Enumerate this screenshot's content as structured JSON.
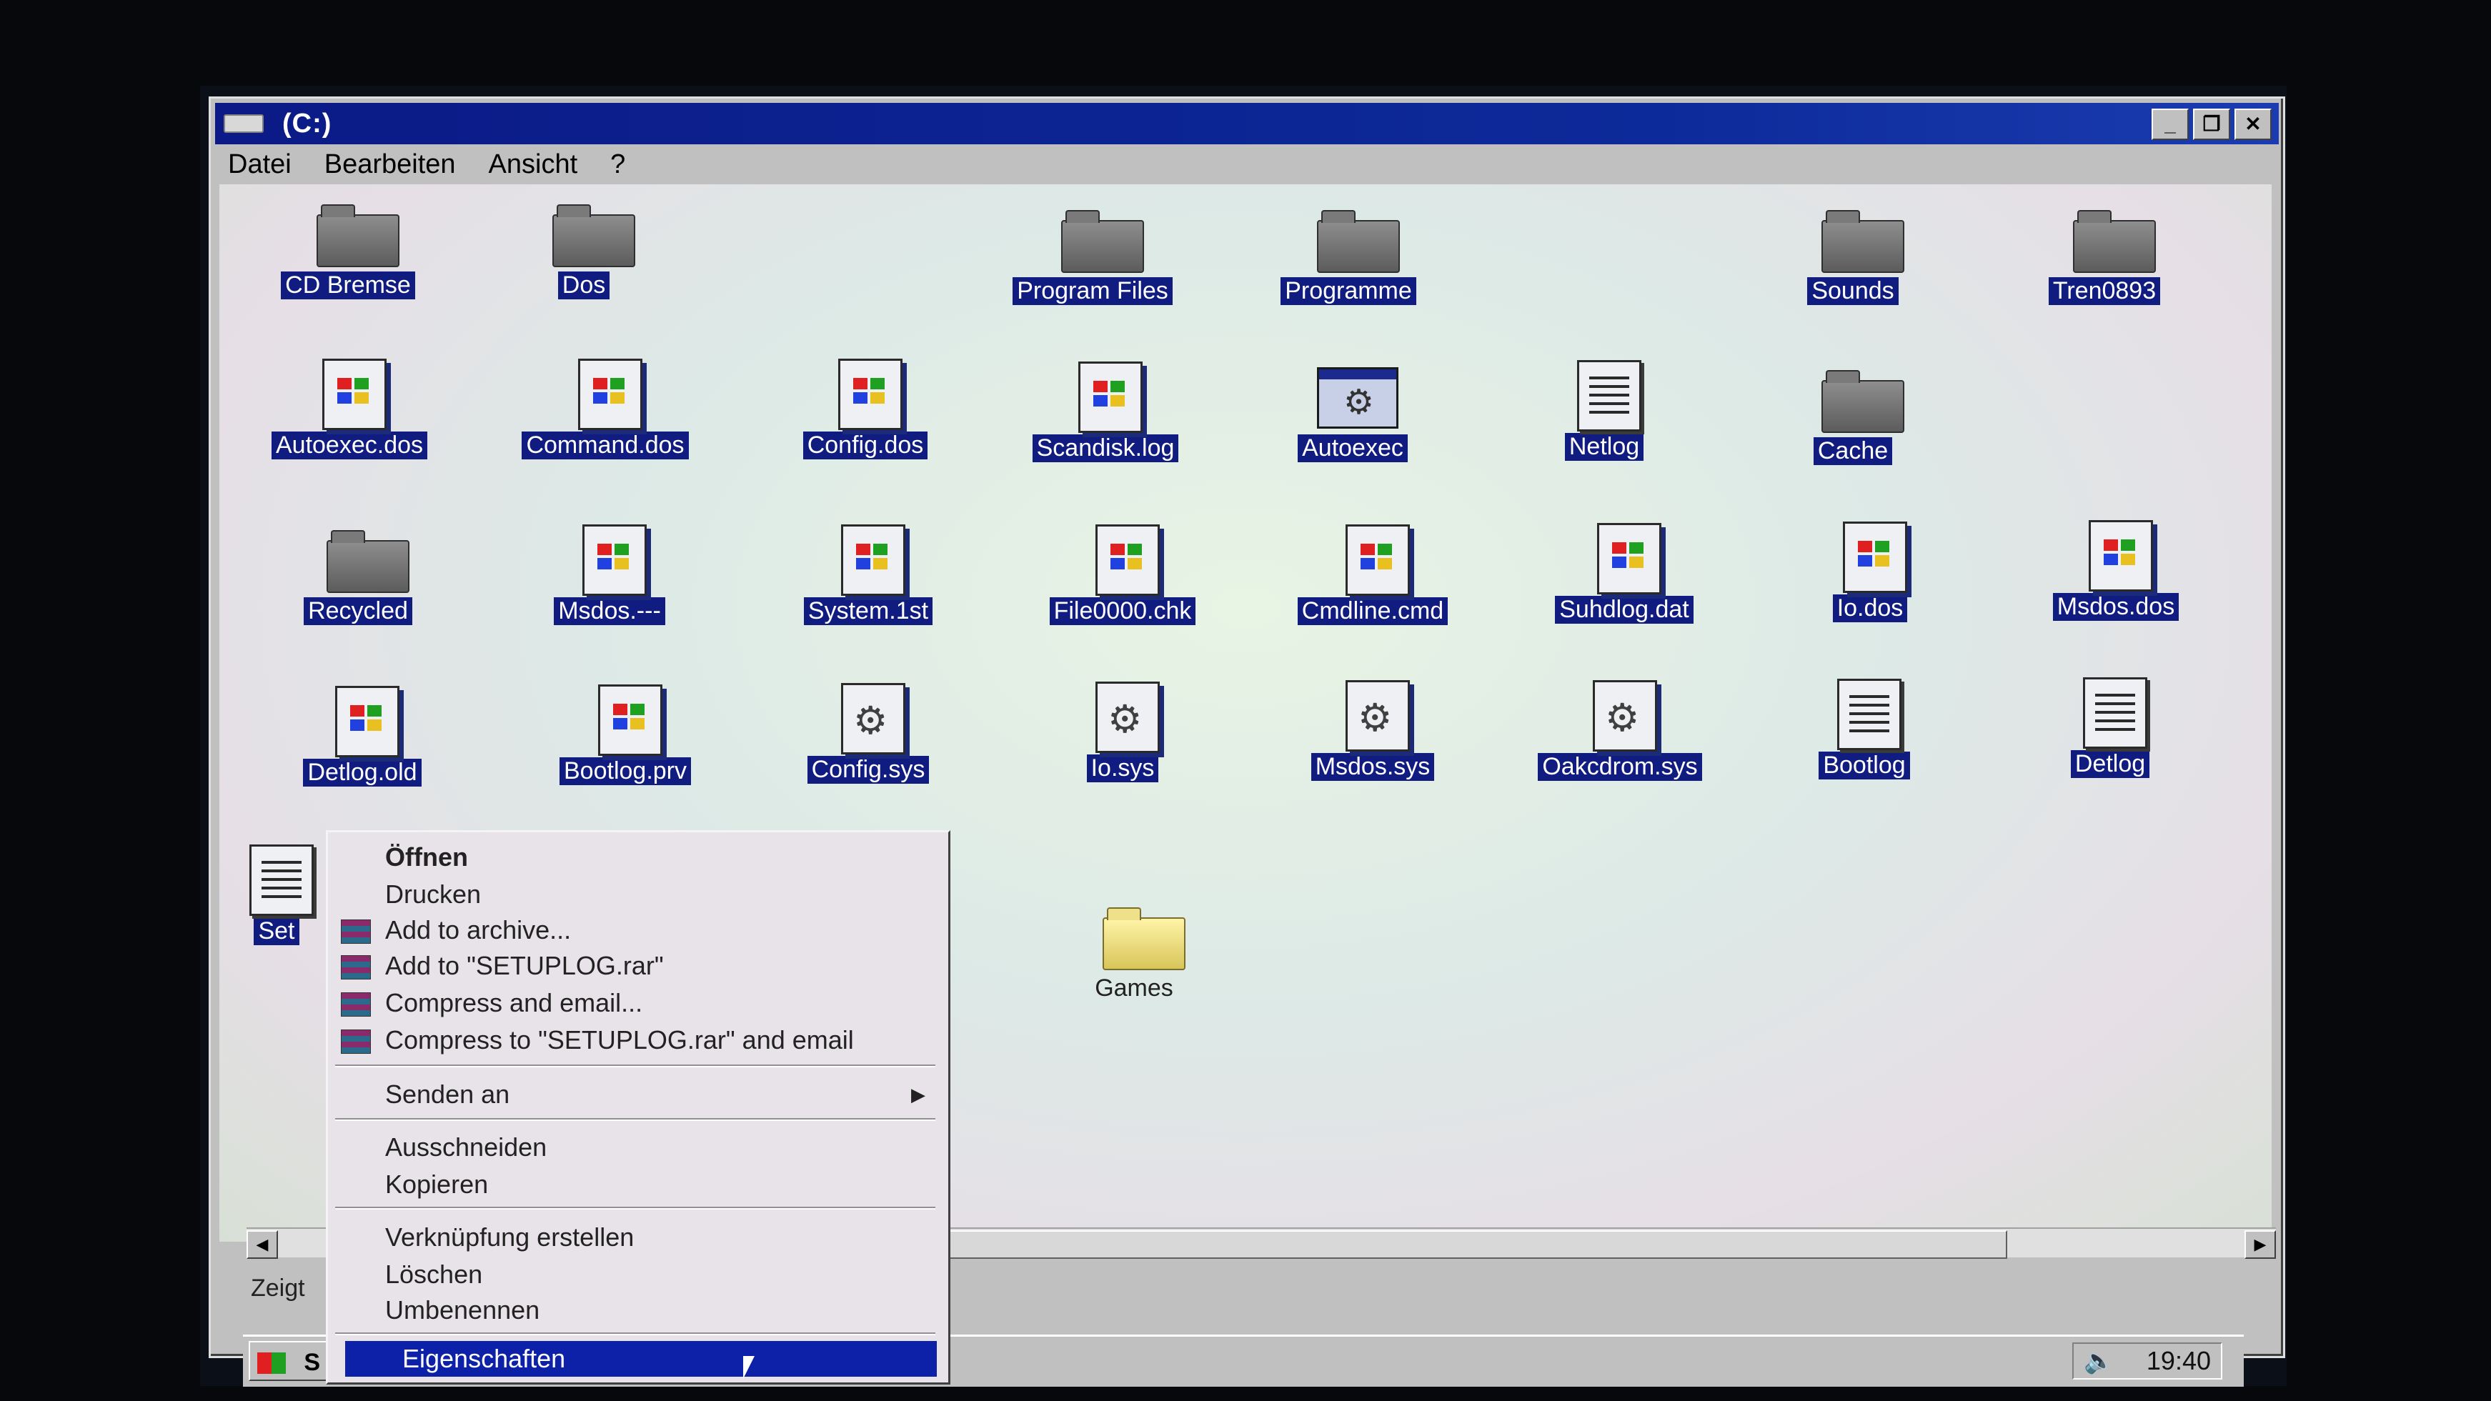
{
  "window": {
    "title": "(C:)",
    "minimize": "_",
    "restore": "❐",
    "close": "✕"
  },
  "menu": [
    "Datei",
    "Bearbeiten",
    "Ansicht",
    "?"
  ],
  "files": [
    {
      "label": "CD Bremse",
      "type": "folder"
    },
    {
      "label": "Dos",
      "type": "folder"
    },
    {
      "label": "Program Files",
      "type": "folder"
    },
    {
      "label": "Programme",
      "type": "folder"
    },
    {
      "label": "Sounds",
      "type": "folder"
    },
    {
      "label": "Tren0893",
      "type": "folder"
    },
    {
      "label": "Autoexec.dos",
      "type": "doc"
    },
    {
      "label": "Command.dos",
      "type": "doc"
    },
    {
      "label": "Config.dos",
      "type": "doc"
    },
    {
      "label": "Scandisk.log",
      "type": "doc"
    },
    {
      "label": "Autoexec",
      "type": "app"
    },
    {
      "label": "Netlog",
      "type": "text"
    },
    {
      "label": "Cache",
      "type": "folder"
    },
    {
      "label": "Recycled",
      "type": "folder"
    },
    {
      "label": "Msdos.---",
      "type": "doc"
    },
    {
      "label": "System.1st",
      "type": "doc"
    },
    {
      "label": "File0000.chk",
      "type": "doc"
    },
    {
      "label": "Cmdline.cmd",
      "type": "doc"
    },
    {
      "label": "Suhdlog.dat",
      "type": "doc"
    },
    {
      "label": "Io.dos",
      "type": "doc"
    },
    {
      "label": "Msdos.dos",
      "type": "doc"
    },
    {
      "label": "Detlog.old",
      "type": "doc"
    },
    {
      "label": "Bootlog.prv",
      "type": "doc"
    },
    {
      "label": "Config.sys",
      "type": "gear"
    },
    {
      "label": "Io.sys",
      "type": "gear"
    },
    {
      "label": "Msdos.sys",
      "type": "gear"
    },
    {
      "label": "Oakcdrom.sys",
      "type": "gear"
    },
    {
      "label": "Bootlog",
      "type": "text"
    },
    {
      "label": "Detlog",
      "type": "text"
    },
    {
      "label": "Set",
      "type": "text"
    },
    {
      "label": "Games",
      "type": "folder-yellow"
    }
  ],
  "context_menu": {
    "open": "Öffnen",
    "print": "Drucken",
    "add_archive": "Add to archive...",
    "add_rar": "Add to \"SETUPLOG.rar\"",
    "compress_email": "Compress and email...",
    "compress_rar_email": "Compress to \"SETUPLOG.rar\" and email",
    "send_to": "Senden an",
    "cut": "Ausschneiden",
    "copy": "Kopieren",
    "shortcut": "Verknüpfung erstellen",
    "delete": "Löschen",
    "rename": "Umbenennen",
    "properties": "Eigenschaften"
  },
  "status": {
    "text": "Zeigt"
  },
  "taskbar": {
    "start": "S",
    "clock": "19:40"
  },
  "colors": {
    "selection": "#0d20a8",
    "titlebar": "#0b1a86"
  }
}
